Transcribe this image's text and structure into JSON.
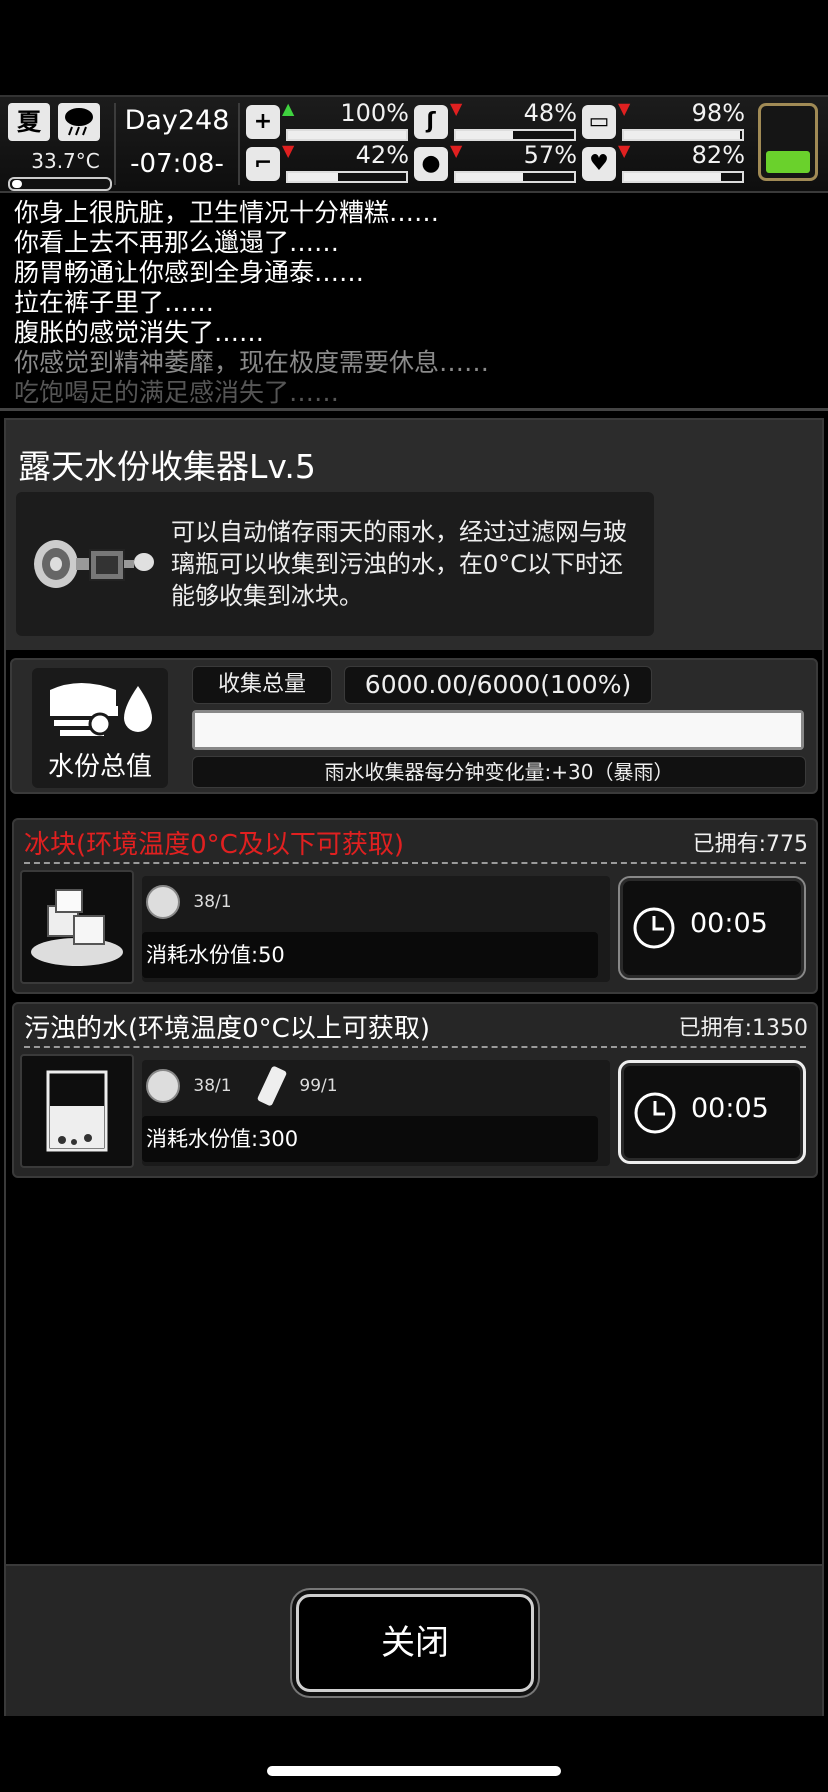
{
  "status": {
    "season": "夏",
    "temperature": "33.7°C",
    "day": "Day248",
    "time": "-07:08-",
    "stats": [
      {
        "name": "health",
        "value": "100%",
        "trend": "up",
        "level": 1.0
      },
      {
        "name": "hunger",
        "value": "48%",
        "trend": "down",
        "level": 0.48
      },
      {
        "name": "hygiene",
        "value": "98%",
        "trend": "down",
        "level": 0.98
      },
      {
        "name": "stamina",
        "value": "42%",
        "trend": "down",
        "level": 0.42
      },
      {
        "name": "thirst",
        "value": "57%",
        "trend": "down",
        "level": 0.57
      },
      {
        "name": "mood",
        "value": "82%",
        "trend": "down",
        "level": 0.82
      }
    ],
    "battery_level": 0.3
  },
  "log": {
    "lines": [
      "你身上很肮脏，卫生情况十分糟糕……",
      "你看上去不再那么邋遢了……",
      "肠胃畅通让你感到全身通泰……",
      "拉在裤子里了……",
      "腹胀的感觉消失了……",
      "你感觉到精神萎靡，现在极度需要休息……",
      "吃饱喝足的满足感消失了……"
    ]
  },
  "panel": {
    "title": "露天水份收集器Lv.5",
    "description": "可以自动储存雨天的雨水，经过过滤网与玻璃瓶可以收集到污浊的水，在0°C以下时还能够收集到冰块。",
    "total_label": "水份总值",
    "collect_label": "收集总量",
    "collect_value": "6000.00/6000(100%)",
    "collect_fill": 1.0,
    "rate_text": "雨水收集器每分钟变化量:+30（暴雨）"
  },
  "recipes": [
    {
      "title": "冰块(环境温度0°C及以下可获取)",
      "title_color": "#e02020",
      "owned": "已拥有:775",
      "materials": [
        "38/1"
      ],
      "cost": "消耗水份值:50",
      "timer": "00:05"
    },
    {
      "title": "污浊的水(环境温度0°C以上可获取)",
      "title_color": "#ffffff",
      "owned": "已拥有:1350",
      "materials": [
        "38/1",
        "99/1"
      ],
      "cost": "消耗水份值:300",
      "timer": "00:05"
    }
  ],
  "footer": {
    "close_label": "关闭"
  }
}
